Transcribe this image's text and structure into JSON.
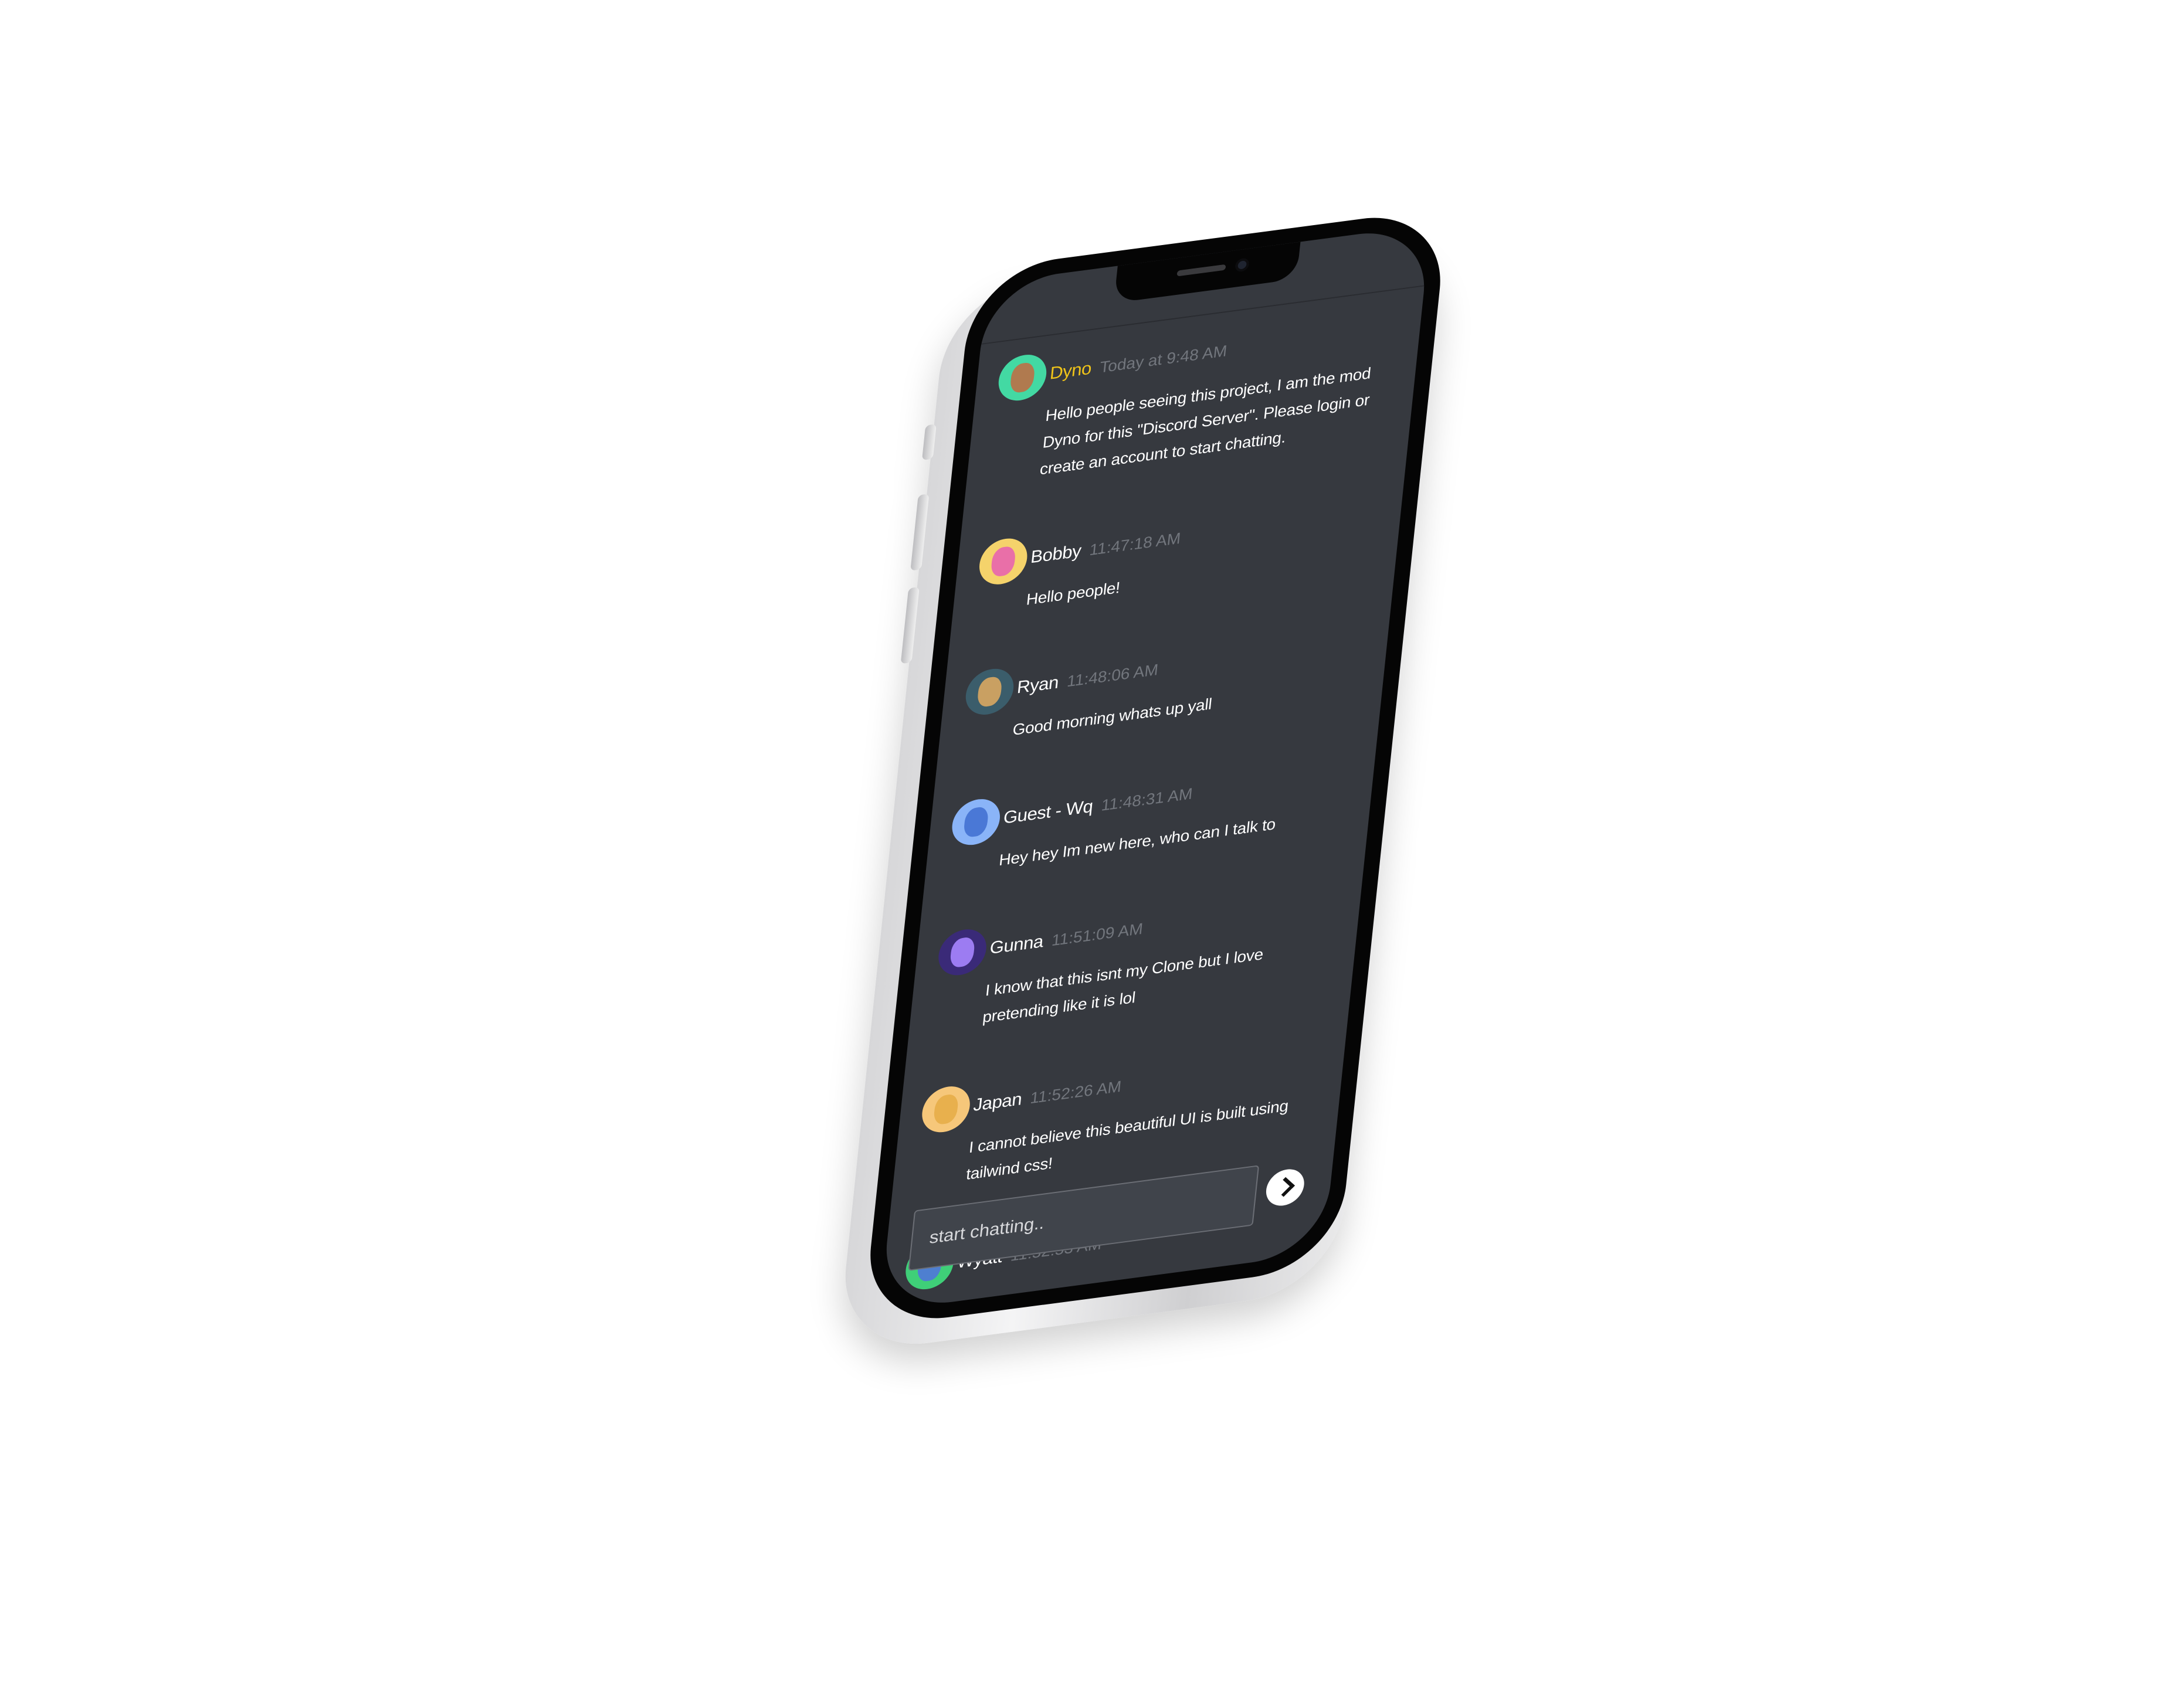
{
  "chat": {
    "messages": [
      {
        "user": "Dyno",
        "time": "Today at 9:48 AM",
        "text": "Hello people seeing this project, I am the mod Dyno for this \"Discord Server\". Please login or create an account to start chatting.",
        "avatar_color": "#43d9a3",
        "face_color": "#b07a4f",
        "mod": true
      },
      {
        "user": "Bobby",
        "time": "11:47:18 AM",
        "text": "Hello people!",
        "avatar_color": "#f5d36b",
        "face_color": "#e96fa8",
        "mod": false
      },
      {
        "user": "Ryan",
        "time": "11:48:06 AM",
        "text": "Good morning whats up yall",
        "avatar_color": "#3b5d6b",
        "face_color": "#c9a062",
        "mod": false
      },
      {
        "user": "Guest - Wq",
        "time": "11:48:31 AM",
        "text": "Hey hey Im new here, who can I talk to",
        "avatar_color": "#8ab4f8",
        "face_color": "#4a78d6",
        "mod": false
      },
      {
        "user": "Gunna",
        "time": "11:51:09 AM",
        "text": "I know that this isnt my Clone but I love pretending like it is lol",
        "avatar_color": "#3a2a78",
        "face_color": "#9c7cf2",
        "mod": false
      },
      {
        "user": "Japan",
        "time": "11:52:26 AM",
        "text": "I cannot believe this beautiful UI is built using tailwind css!",
        "avatar_color": "#f6c77a",
        "face_color": "#e8b04d",
        "mod": false
      },
      {
        "user": "Wyatt",
        "time": "11:52:53 AM",
        "text": "",
        "avatar_color": "#3fcf78",
        "face_color": "#4e7fd0",
        "mod": false
      }
    ],
    "composer_placeholder": "start chatting..",
    "send_icon": "chevron-right-icon"
  },
  "colors": {
    "screen_bg": "#36393f",
    "mod_name": "#f0c419",
    "timestamp": "#72767d"
  }
}
